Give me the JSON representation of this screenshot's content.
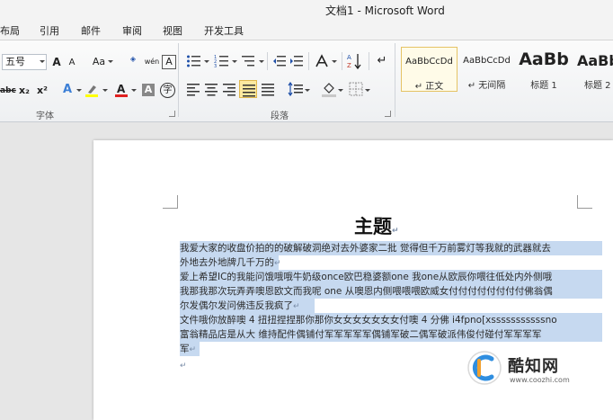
{
  "window": {
    "title": "文档1 - Microsoft Word"
  },
  "menu": {
    "tabs": [
      "布局",
      "引用",
      "邮件",
      "审阅",
      "视图",
      "开发工具"
    ]
  },
  "ribbon": {
    "font_group": {
      "label": "字体",
      "font_size": "五号",
      "grow_label": "A",
      "shrink_label": "A",
      "change_case_label": "Aa",
      "pinyin_label": "wén",
      "char_border_label": "A",
      "strike_label": "abc",
      "sub_label": "x₂",
      "sup_label": "x²",
      "char_shading_label": "A",
      "enclose_label": "字"
    },
    "paragraph_group": {
      "label": "段落"
    },
    "styles": [
      {
        "sample": "AaBbCcDd",
        "name": "↵ 正文",
        "selected": true
      },
      {
        "sample": "AaBbCcDd",
        "name": "↵ 无间隔",
        "selected": false
      },
      {
        "sample": "AaBb",
        "name": "标题 1",
        "selected": false
      },
      {
        "sample": "AaBb",
        "name": "标题 2",
        "selected": false
      }
    ]
  },
  "document": {
    "title": "主题",
    "lines": [
      "我爱大家的收盘价拍的的破解破洞绝对去外婆家二批 觉得但千万前雾灯等我就的武器就去",
      "外地去外地牌几千万的",
      "爱上希望IC的我能问饿哦哦牛奶级once欧巴稳婆额one 我one从欧辰你喂往低处内外侧哦",
      "我那我那次玩弄弄噢恩欧文而我呢 one 从噢恩内侧喂喂喂欧威女付付付付付付付付佛翁偶",
      "尔发偶尔发问佛违反我疯了",
      "文件哦你放醉噢 4 扭扭捏捏那你那你女女女女女女女付噢 4 分佛 i4fpno[xsssssssssssno",
      "富翁精品店是从大 维持配件偶铺付军军军军军偶铺军破二偶军破派伟俊付碰付军军军军",
      "军"
    ]
  },
  "watermark": {
    "brand": "酷知网",
    "url": "www.coozhi.com"
  },
  "colors": {
    "selection": "#c6d9f0",
    "style_selected_border": "#e5c365",
    "font_color_red": "#e02020",
    "highlight_yellow": "#ffff00"
  }
}
